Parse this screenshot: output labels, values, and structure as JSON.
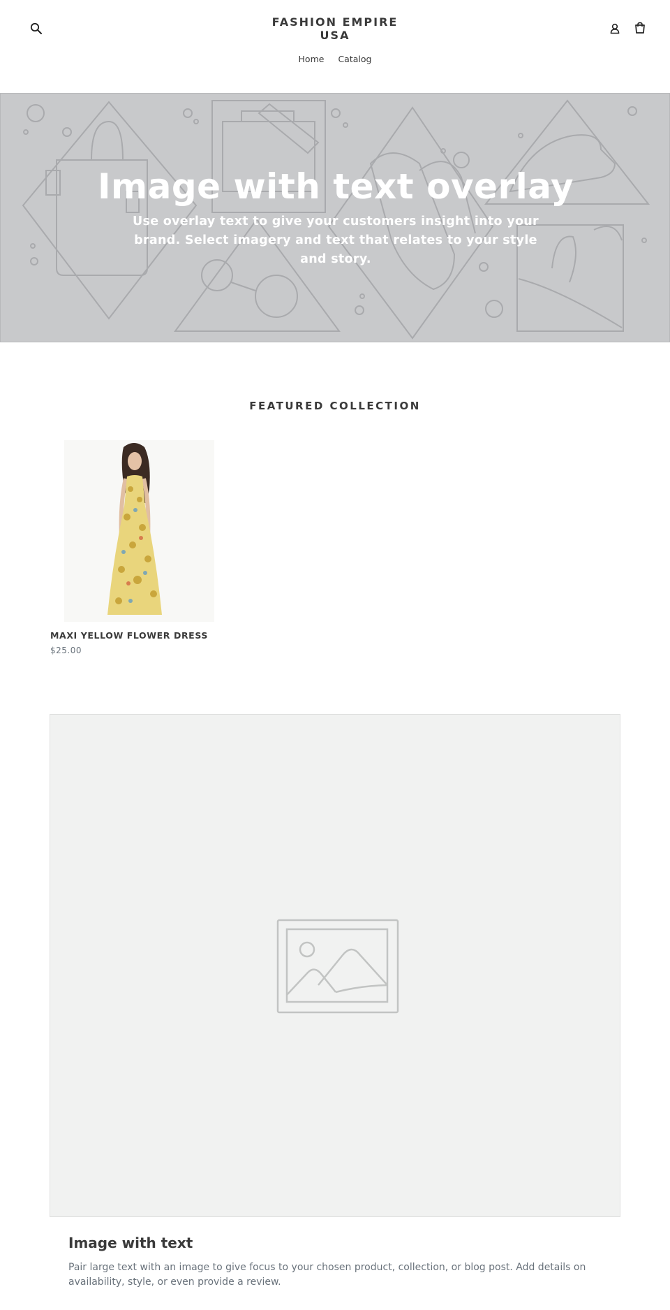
{
  "header": {
    "logo_text": "FASHION EMPIRE USA",
    "nav": [
      {
        "label": "Home"
      },
      {
        "label": "Catalog"
      }
    ],
    "icons": {
      "search": "search-icon",
      "account": "account-icon",
      "cart": "cart-icon"
    }
  },
  "hero": {
    "title": "Image with text overlay",
    "subtitle": "Use overlay text to give your customers insight into your brand. Select imagery and text that relates to your style and story.",
    "background_color": "#c8c9cb"
  },
  "featured": {
    "title": "FEATURED COLLECTION",
    "products": [
      {
        "title": "MAXI YELLOW FLOWER DRESS",
        "price": "$25.00"
      }
    ]
  },
  "image_with_text": {
    "title": "Image with text",
    "text": "Pair large text with an image to give focus to your chosen product, collection, or blog post. Add details on availability, style, or even provide a review.",
    "placeholder_icon": "image-placeholder-icon"
  }
}
